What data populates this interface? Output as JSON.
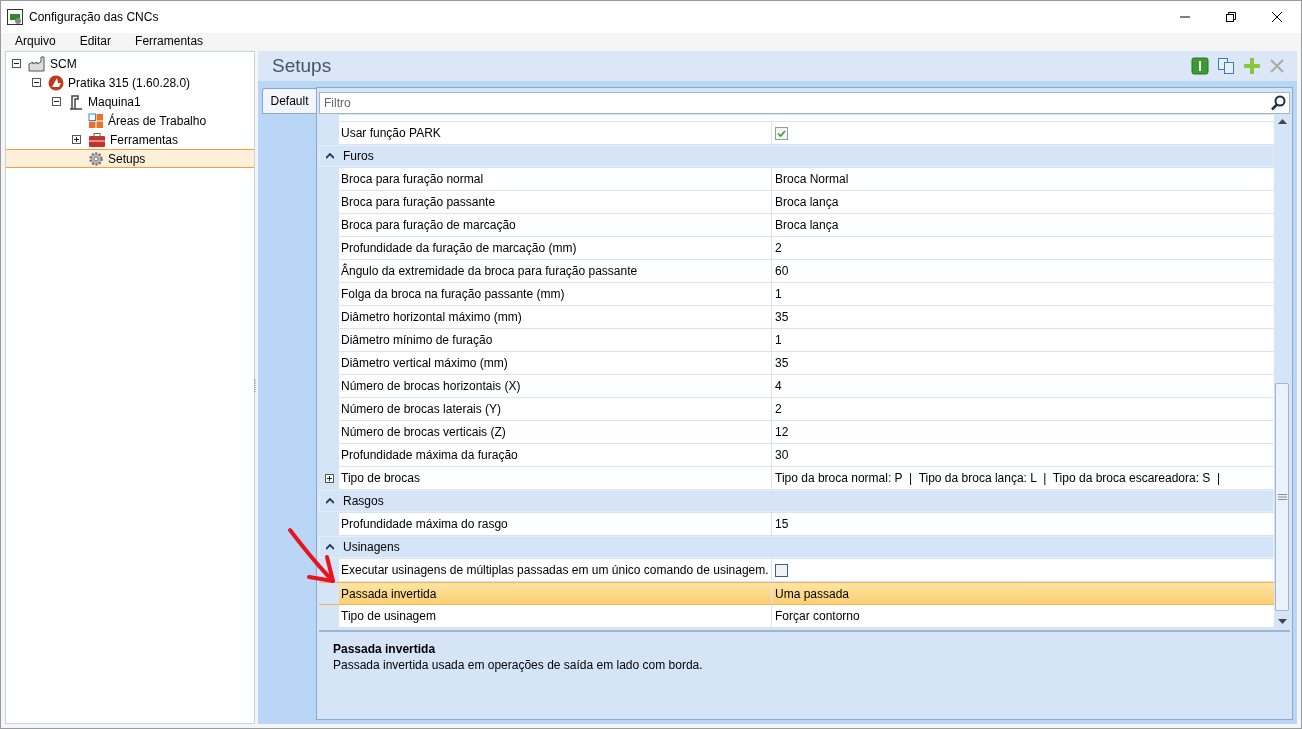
{
  "window": {
    "title": "Configuração das CNCs"
  },
  "menu": [
    "Arquivo",
    "Editar",
    "Ferramentas"
  ],
  "tree": [
    {
      "label": "SCM",
      "kind": "plant",
      "expanded": true,
      "selected": false,
      "children": [
        {
          "label": "Pratika 315 (1.60.28.0)",
          "kind": "model",
          "expanded": true,
          "selected": false,
          "children": [
            {
              "label": "Maquina1",
              "kind": "machine",
              "expanded": true,
              "selected": false,
              "children": [
                {
                  "label": "Áreas de Trabalho",
                  "kind": "areas",
                  "selected": false
                },
                {
                  "label": "Ferramentas",
                  "kind": "tools",
                  "expanded": false,
                  "selected": false
                },
                {
                  "label": "Setups",
                  "kind": "setups",
                  "selected": true
                }
              ]
            }
          ]
        }
      ]
    }
  ],
  "panel": {
    "title": "Setups"
  },
  "tabs": [
    {
      "label": "Default",
      "selected": true
    }
  ],
  "filter": {
    "placeholder": "Filtro"
  },
  "sections": [
    {
      "rows": [
        {
          "name": "Usar função PARK",
          "kind": "checkbox",
          "checked": true,
          "selected": false
        }
      ]
    },
    {
      "title": "Furos",
      "expanded": true,
      "rows": [
        {
          "name": "Broca para furação normal",
          "kind": "text",
          "value": "Broca Normal",
          "selected": false
        },
        {
          "name": "Broca para furação passante",
          "kind": "text",
          "value": "Broca lança",
          "selected": false
        },
        {
          "name": "Broca para furação de marcação",
          "kind": "text",
          "value": "Broca lança",
          "selected": false
        },
        {
          "name": "Profundidade da furação de marcação (mm)",
          "kind": "text",
          "value": "2",
          "selected": false
        },
        {
          "name": "Ângulo da extremidade da broca para furação passante",
          "kind": "text",
          "value": "60",
          "selected": false
        },
        {
          "name": "Folga da broca na furação passante (mm)",
          "kind": "text",
          "value": "1",
          "selected": false
        },
        {
          "name": "Diâmetro horizontal máximo (mm)",
          "kind": "text",
          "value": "35",
          "selected": false
        },
        {
          "name": "Diâmetro mínimo de furação",
          "kind": "text",
          "value": "1",
          "selected": false
        },
        {
          "name": "Diâmetro vertical máximo (mm)",
          "kind": "text",
          "value": "35",
          "selected": false
        },
        {
          "name": "Número de brocas horizontais (X)",
          "kind": "text",
          "value": "4",
          "selected": false
        },
        {
          "name": "Número de brocas laterais (Y)",
          "kind": "text",
          "value": "2",
          "selected": false
        },
        {
          "name": "Número de brocas verticais (Z)",
          "kind": "text",
          "value": "12",
          "selected": false
        },
        {
          "name": "Profundidade máxima da furação",
          "kind": "text",
          "value": "30",
          "selected": false
        },
        {
          "name": "Tipo de brocas",
          "kind": "text",
          "value": "Tipo da broca normal: P  |  Tipo da broca lança: L  |  Tipo da broca escareadora: S  |",
          "expanded": false,
          "selected": false
        }
      ]
    },
    {
      "title": "Rasgos",
      "expanded": true,
      "rows": [
        {
          "name": "Profundidade máxima do rasgo",
          "kind": "text",
          "value": "15",
          "selected": false
        }
      ]
    },
    {
      "title": "Usinagens",
      "expanded": true,
      "rows": [
        {
          "name": "Executar usinagens de múltiplas passadas em um único comando de usinagem.",
          "kind": "checkbox",
          "checked": false,
          "selected": false
        },
        {
          "name": "Passada invertida",
          "kind": "text",
          "value": "Uma passada",
          "selected": true
        },
        {
          "name": "Tipo de usinagem",
          "kind": "text",
          "value": "Forçar contorno",
          "selected": false
        }
      ]
    }
  ],
  "description": {
    "title": "Passada invertida",
    "text": "Passada invertida usada em operações de saída em lado com borda."
  }
}
